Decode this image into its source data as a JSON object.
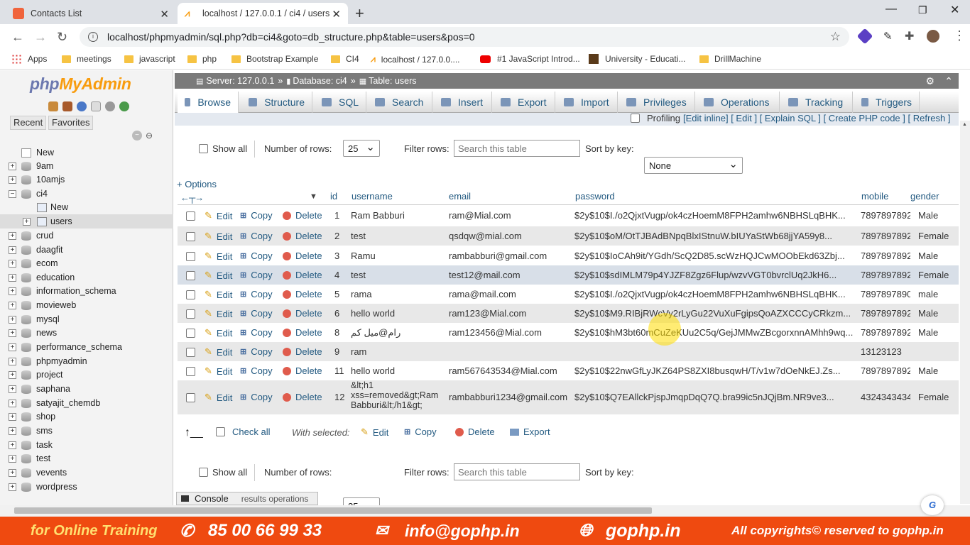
{
  "browser": {
    "tabs": [
      {
        "title": "Contacts List"
      },
      {
        "title": "localhost / 127.0.0.1 / ci4 / users"
      }
    ],
    "url": "localhost/phpmyadmin/sql.php?db=ci4&goto=db_structure.php&table=users&pos=0",
    "bookmarks": [
      "Apps",
      "meetings",
      "javascript",
      "php",
      "Bootstrap Example",
      "CI4",
      "localhost / 127.0.0....",
      "#1 JavaScript Introd...",
      "University - Educati...",
      "DrillMachine"
    ]
  },
  "pma": {
    "logo_a": "php",
    "logo_b": "MyAdmin",
    "recent": "Recent",
    "favorites": "Favorites",
    "tree": [
      {
        "label": "New",
        "level": 0
      },
      {
        "label": "9am",
        "level": 0
      },
      {
        "label": "10amjs",
        "level": 0
      },
      {
        "label": "ci4",
        "level": 0
      },
      {
        "label": "New",
        "level": 1
      },
      {
        "label": "users",
        "level": 1
      },
      {
        "label": "crud",
        "level": 0
      },
      {
        "label": "daagfit",
        "level": 0
      },
      {
        "label": "ecom",
        "level": 0
      },
      {
        "label": "education",
        "level": 0
      },
      {
        "label": "information_schema",
        "level": 0
      },
      {
        "label": "movieweb",
        "level": 0
      },
      {
        "label": "mysql",
        "level": 0
      },
      {
        "label": "news",
        "level": 0
      },
      {
        "label": "performance_schema",
        "level": 0
      },
      {
        "label": "phpmyadmin",
        "level": 0
      },
      {
        "label": "project",
        "level": 0
      },
      {
        "label": "saphana",
        "level": 0
      },
      {
        "label": "satyajit_chemdb",
        "level": 0
      },
      {
        "label": "shop",
        "level": 0
      },
      {
        "label": "sms",
        "level": 0
      },
      {
        "label": "task",
        "level": 0
      },
      {
        "label": "test",
        "level": 0
      },
      {
        "label": "vevents",
        "level": 0
      },
      {
        "label": "wordpress",
        "level": 0
      }
    ]
  },
  "main": {
    "breadcrumb": {
      "server": "Server: 127.0.0.1",
      "db": "Database: ci4",
      "table": "Table: users"
    },
    "tabs": [
      "Browse",
      "Structure",
      "SQL",
      "Search",
      "Insert",
      "Export",
      "Import",
      "Privileges",
      "Operations",
      "Tracking",
      "Triggers"
    ],
    "profiling": {
      "label": "Profiling",
      "links": "[Edit inline] [ Edit ] [ Explain SQL ] [ Create PHP code ] [ Refresh ]"
    },
    "controls": {
      "show_all": "Show all",
      "number_rows": "Number of rows:",
      "rows_value": "25",
      "filter_rows": "Filter rows:",
      "filter_placeholder": "Search this table",
      "sort_key": "Sort by key:",
      "sort_value": "None"
    },
    "options": "+ Options",
    "columns": [
      "id",
      "username",
      "email",
      "password",
      "mobile",
      "gender"
    ],
    "actions": {
      "edit": "Edit",
      "copy": "Copy",
      "delete": "Delete"
    },
    "rows": [
      {
        "id": "1",
        "username": "Ram Babburi",
        "email": "ram@Mial.com",
        "password": "$2y$10$I./o2QjxtVugp/ok4czHoemM8FPH2amhw6NBHSLqBHK...",
        "mobile": "7897897892",
        "gender": "Male"
      },
      {
        "id": "2",
        "username": "test",
        "email": "qsdqw@mial.com",
        "password": "$2y$10$oM/OtTJBAdBNpqBlxIStnuW.bIUYaStWb68jjYA59y8...",
        "mobile": "7897897892",
        "gender": "Female"
      },
      {
        "id": "3",
        "username": "Ramu",
        "email": "rambabburi@gmail.com",
        "password": "$2y$10$IoCAh9it/YGdh/ScQ2D85.scWzHQJCwMOObEkd63Zbj...",
        "mobile": "7897897892",
        "gender": "Male"
      },
      {
        "id": "4",
        "username": "test",
        "email": "test12@mail.com",
        "password": "$2y$10$sdIMLM79p4YJZF8Zgz6Flup/wzvVGT0bvrclUq2JkH6...",
        "mobile": "7897897892",
        "gender": "Female"
      },
      {
        "id": "5",
        "username": "rama",
        "email": "rama@mail.com",
        "password": "$2y$10$I./o2QjxtVugp/ok4czHoemM8FPH2amhw6NBHSLqBHK...",
        "mobile": "7897897890",
        "gender": "male"
      },
      {
        "id": "6",
        "username": "hello world",
        "email": "ram123@Mial.com",
        "password": "$2y$10$M9.RIBjRWcVy2rLyGu22VuXuFgipsQoAZXCCCyCRkzm...",
        "mobile": "7897897892",
        "gender": "Male"
      },
      {
        "id": "8",
        "username": "رام@میل کم",
        "email": "ram123456@Mial.com",
        "password": "$2y$10$hM3bt60mCuZeKUu2C5q/GejJMMwZBcgorxnnAMhh9wq...",
        "mobile": "7897897892",
        "gender": "Male"
      },
      {
        "id": "9",
        "username": "ram",
        "email": "",
        "password": "",
        "mobile": "13123123",
        "gender": ""
      },
      {
        "id": "11",
        "username": "hello world",
        "email": "ram567643534@Mial.com",
        "password": "$2y$10$22nwGfLyJKZ64PS8ZXI8busqwH/T/v1w7dOeNkEJ.Zs...",
        "mobile": "7897897892",
        "gender": "Male"
      },
      {
        "id": "12",
        "username": "&lt;h1 xss=removed&gt;Ram Babburi&lt;/h1&gt;",
        "email": "rambabburi1234@gmail.com",
        "password": "$2y$10$Q7EAllckPjspJmqpDqQ7Q.bra99ic5nJQjBm.NR9ve3...",
        "mobile": "4324343434",
        "gender": "Female"
      }
    ],
    "bulk": {
      "check_all": "Check all",
      "with_selected": "With selected:",
      "edit": "Edit",
      "copy": "Copy",
      "delete": "Delete",
      "export": "Export"
    },
    "console": "Console",
    "results_ops": "results operations"
  },
  "footer": {
    "training": "for Online Training",
    "phone": "85 00 66 99 33",
    "email": "info@gophp.in",
    "site": "gophp.in",
    "copyright": "All copyrights© reserved to gophp.in"
  },
  "colors": {
    "footer": "#ef4a10",
    "link": "#235a81",
    "crumb": "#7a7a7a",
    "highlight_row": "#d8dfe8"
  }
}
